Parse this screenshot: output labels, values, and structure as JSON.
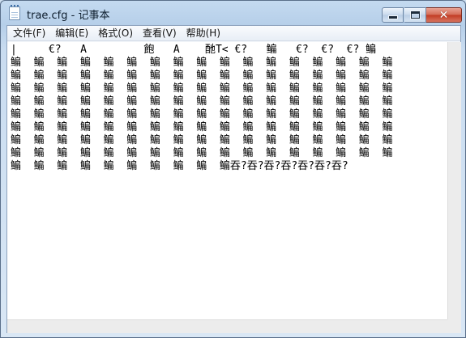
{
  "window": {
    "title": "trae.cfg - 记事本",
    "controls": {
      "minimize_icon": "minimize-icon",
      "maximize_icon": "maximize-icon",
      "close_icon": "close-icon",
      "close_glyph": "✕"
    }
  },
  "menu": [
    {
      "label": "文件(F)"
    },
    {
      "label": "编辑(E)"
    },
    {
      "label": "格式(O)"
    },
    {
      "label": "查看(V)"
    },
    {
      "label": "帮助(H)"
    }
  ],
  "editor": {
    "content": "|     €?   A         飽   A    酏T< €?   鳊   €?  €?  €? 鳊\n鳊  鳊  鳊  鳊  鳊  鳊  鳊  鳊  鳊  鳊  鳊  鳊  鳊  鳊  鳊  鳊  鳊\n鳊  鳊  鳊  鳊  鳊  鳊  鳊  鳊  鳊  鳊  鳊  鳊  鳊  鳊  鳊  鳊  鳊\n鳊  鳊  鳊  鳊  鳊  鳊  鳊  鳊  鳊  鳊  鳊  鳊  鳊  鳊  鳊  鳊  鳊\n鳊  鳊  鳊  鳊  鳊  鳊  鳊  鳊  鳊  鳊  鳊  鳊  鳊  鳊  鳊  鳊  鳊\n鳊  鳊  鳊  鳊  鳊  鳊  鳊  鳊  鳊  鳊  鳊  鳊  鳊  鳊  鳊  鳊  鳊\n鳊  鳊  鳊  鳊  鳊  鳊  鳊  鳊  鳊  鳊  鳊  鳊  鳊  鳊  鳊  鳊  鳊\n鳊  鳊  鳊  鳊  鳊  鳊  鳊  鳊  鳊  鳊  鳊  鳊  鳊  鳊  鳊  鳊  鳊\n鳊  鳊  鳊  鳊  鳊  鳊  鳊  鳊  鳊  鳊  鳊  鳊  鳊  鳊  鳊  鳊  鳊\n鳊  鳊  鳊  鳊  鳊  鳊  鳊  鳊  鳊  鳊吞?吞?吞?吞?吞?吞?吞?"
  }
}
